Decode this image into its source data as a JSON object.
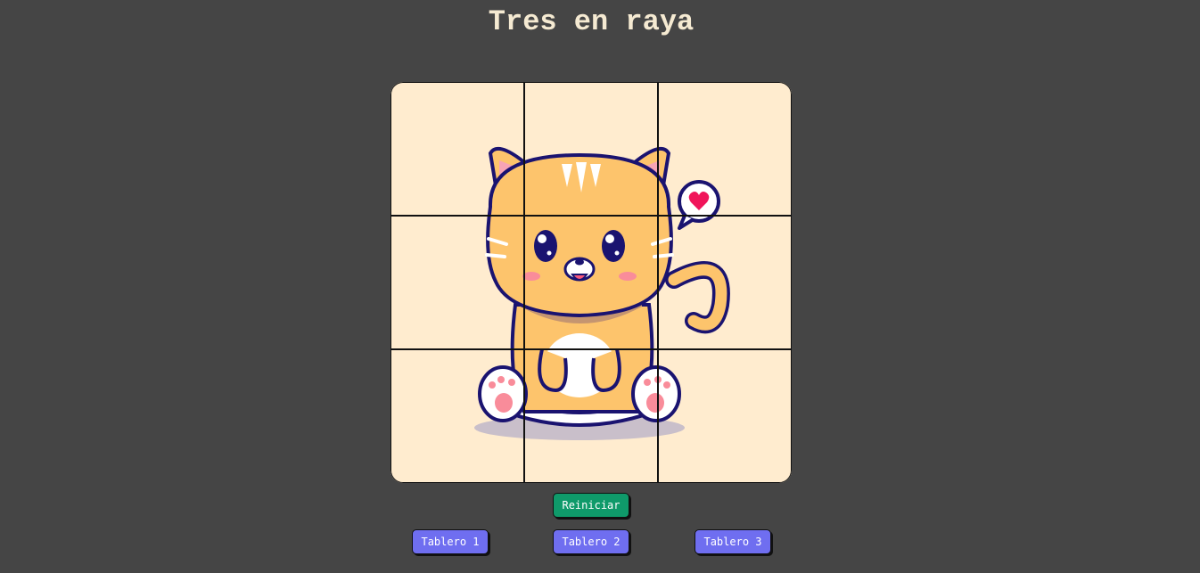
{
  "page": {
    "title": "Tres en raya"
  },
  "board": {
    "rows": 3,
    "cols": 3,
    "cells": [
      "",
      "",
      "",
      "",
      "",
      "",
      "",
      "",
      ""
    ],
    "background_image": "cute-kitten-with-heart-bubble"
  },
  "controls": {
    "reset_label": "Reiniciar",
    "board_buttons": [
      "Tablero 1",
      "Tablero 2",
      "Tablero 3"
    ]
  },
  "colors": {
    "page_background": "#454545",
    "title": "#f5ead2",
    "board_background": "#ffeccf",
    "reset_button": "#0f9a6a",
    "board_button": "#6f6ef0"
  }
}
